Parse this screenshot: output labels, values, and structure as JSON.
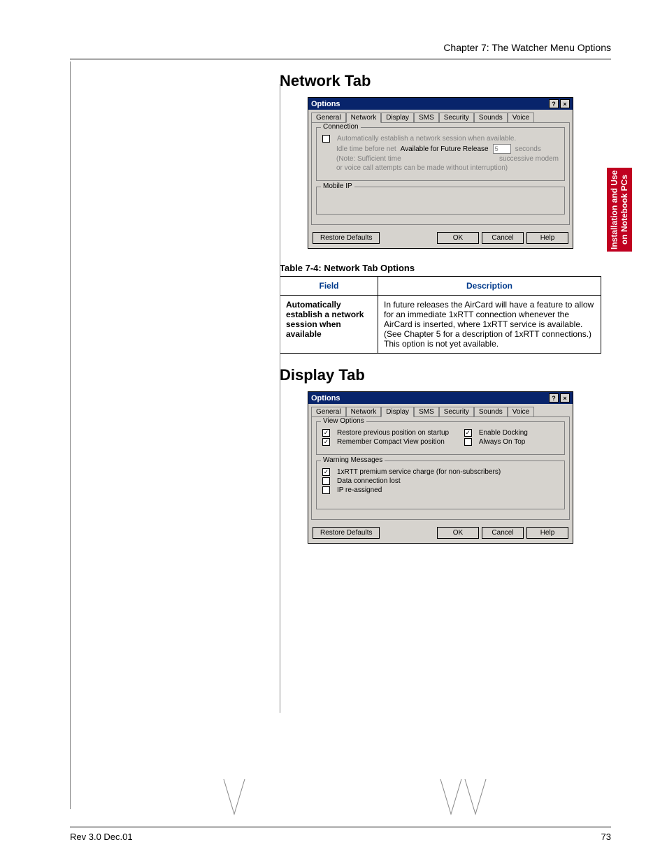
{
  "chapter_header": "Chapter 7: The Watcher Menu Options",
  "side_tab": "Installation and Use\non Notebook PCs",
  "section1": {
    "title": "Network Tab",
    "dialog": {
      "title": "Options",
      "tabs": [
        "General",
        "Network",
        "Display",
        "SMS",
        "Security",
        "Sounds",
        "Voice"
      ],
      "active_tab": 1,
      "group1_label": "Connection",
      "auto_establish": "Automatically establish a network session when available.",
      "idle_label": "Idle time before net",
      "future_release": "Available for Future Release",
      "seconds_value": "5",
      "seconds_label": "seconds",
      "note_line1": "(Note: Sufficient time",
      "note_line2_rest": "successive modem",
      "note_line3": "or voice call attempts can be made without interruption)",
      "group2_label": "Mobile IP",
      "buttons": {
        "restore": "Restore Defaults",
        "ok": "OK",
        "cancel": "Cancel",
        "help": "Help"
      }
    },
    "table_caption": "Table 7-4:  Network Tab Options",
    "table": {
      "h1": "Field",
      "h2": "Description",
      "r1_field": "Automatically establish a network session when available",
      "r1_desc": "In future releases the AirCard will have a feature to allow for an immediate 1xRTT connection whenever the AirCard is inserted, where 1xRTT service is available. (See Chapter 5 for a description of 1xRTT connections.) This option is not yet available."
    }
  },
  "section2": {
    "title": "Display Tab",
    "dialog": {
      "title": "Options",
      "tabs": [
        "General",
        "Network",
        "Display",
        "SMS",
        "Security",
        "Sounds",
        "Voice"
      ],
      "active_tab": 2,
      "group1_label": "View Options",
      "restore_pos": "Restore previous position on startup",
      "remember_compact": "Remember Compact View position",
      "enable_docking": "Enable Docking",
      "always_on_top": "Always On Top",
      "group2_label": "Warning Messages",
      "warn1": "1xRTT premium service charge (for non-subscribers)",
      "warn2": "Data connection lost",
      "warn3": "IP re-assigned",
      "buttons": {
        "restore": "Restore Defaults",
        "ok": "OK",
        "cancel": "Cancel",
        "help": "Help"
      }
    }
  },
  "footer": {
    "rev": "Rev 3.0  Dec.01",
    "page": "73"
  }
}
